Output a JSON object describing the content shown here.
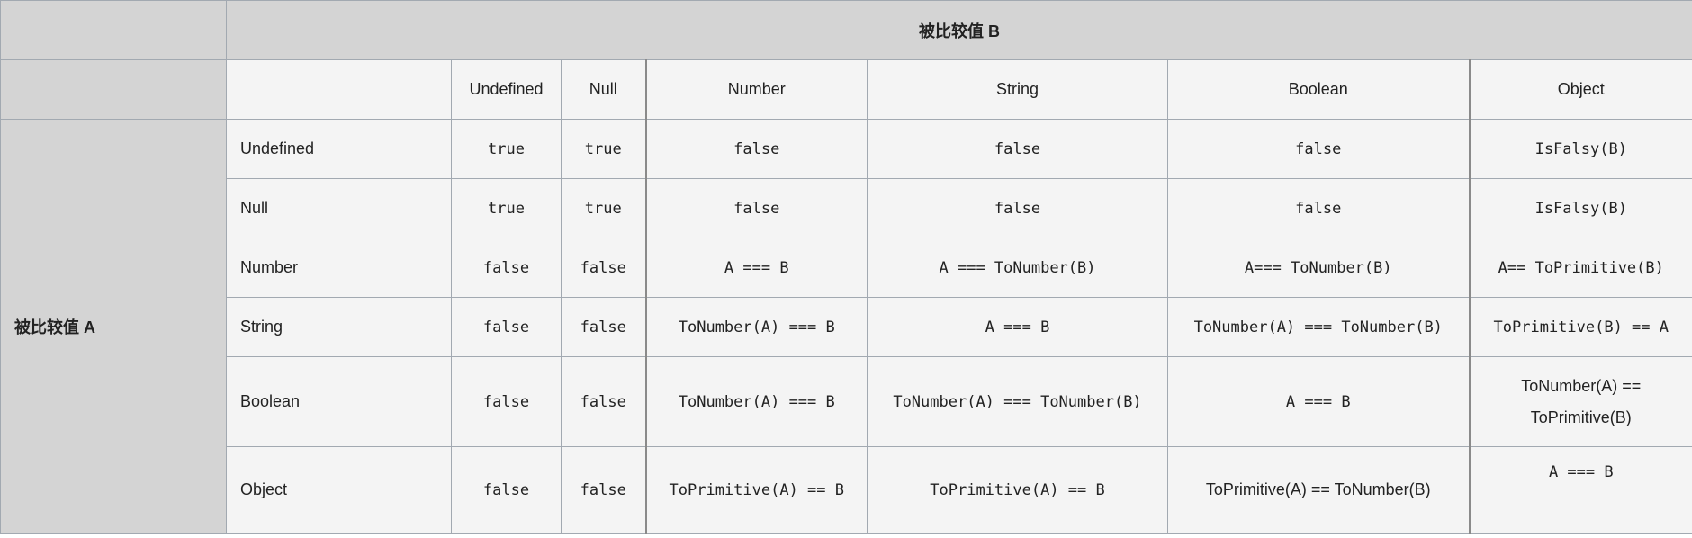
{
  "table": {
    "title_b": "被比较值 B",
    "title_a": "被比较值 A",
    "column_headers": [
      "Undefined",
      "Null",
      "Number",
      "String",
      "Boolean",
      "Object"
    ],
    "rows": [
      {
        "label": "Undefined",
        "cells": [
          "true",
          "true",
          "false",
          "false",
          "false",
          "IsFalsy(B)"
        ]
      },
      {
        "label": "Null",
        "cells": [
          "true",
          "true",
          "false",
          "false",
          "false",
          "IsFalsy(B)"
        ]
      },
      {
        "label": "Number",
        "cells": [
          "false",
          "false",
          "A === B",
          "A === ToNumber(B)",
          "A=== ToNumber(B)",
          "A== ToPrimitive(B)"
        ]
      },
      {
        "label": "String",
        "cells": [
          "false",
          "false",
          "ToNumber(A) === B",
          "A === B",
          "ToNumber(A) === ToNumber(B)",
          "ToPrimitive(B) == A"
        ]
      },
      {
        "label": "Boolean",
        "cells": [
          "false",
          "false",
          "ToNumber(A) === B",
          "ToNumber(A) === ToNumber(B)",
          "A === B",
          "ToNumber(A) == ToPrimitive(B)"
        ]
      },
      {
        "label": "Object",
        "cells": [
          "false",
          "false",
          "ToPrimitive(A) == B",
          "ToPrimitive(A) == B",
          "ToPrimitive(A) == ToNumber(B)",
          "A === B"
        ]
      }
    ]
  }
}
